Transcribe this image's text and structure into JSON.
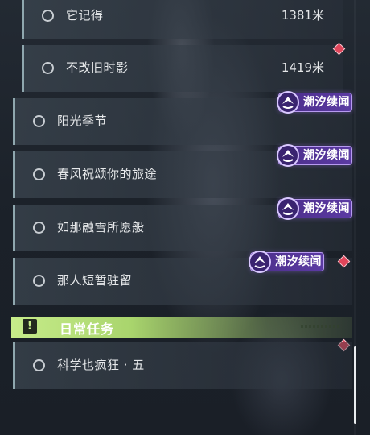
{
  "quests": [
    {
      "name": "它记得",
      "distance": "1381米"
    },
    {
      "name": "不改旧时影",
      "distance": "1419米"
    },
    {
      "name": "阳光季节"
    },
    {
      "name": "春风祝颂你的旅途"
    },
    {
      "name": "如那融雪所愿般"
    },
    {
      "name": "那人短暂驻留"
    }
  ],
  "badge_label": "潮汐续闻",
  "section": {
    "title": "日常任务",
    "icon_glyph": "!"
  },
  "daily_quests": [
    {
      "name": "科学也疯狂 · 五"
    }
  ],
  "colors": {
    "badge": "#5b3aa3",
    "section_green": "#c7ec8a",
    "alert": "#e0455a",
    "row_border": "#8fa7ae"
  }
}
